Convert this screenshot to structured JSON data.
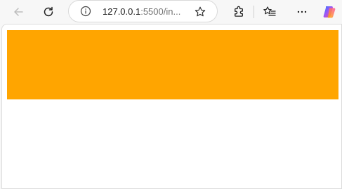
{
  "browser": {
    "address_host": "127.0.0.1",
    "address_rest": ":5500/in...",
    "icons": {
      "back": "back-arrow-icon",
      "refresh": "refresh-icon",
      "info": "info-icon",
      "favorite": "star-icon",
      "extensions": "puzzle-icon",
      "favorites": "favorites-list-icon",
      "more": "more-dots-icon",
      "copilot": "copilot-icon"
    }
  },
  "page": {
    "box_color": "#FFA500",
    "background": "#FFFFFF"
  }
}
